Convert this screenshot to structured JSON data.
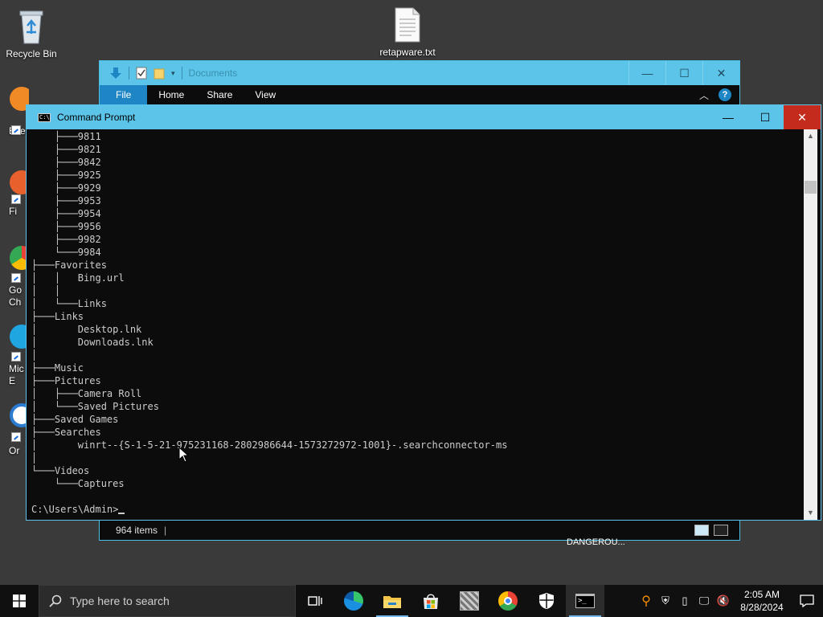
{
  "desktop": {
    "icons": [
      {
        "label": "Recycle Bin",
        "icon": "recycle-bin-icon"
      },
      {
        "label": "retapware.txt",
        "icon": "text-file-icon"
      }
    ],
    "partial_icons": [
      {
        "label": "Ever",
        "icon": "app-icon",
        "color": "#f08a24"
      },
      {
        "label": "Fi",
        "icon": "firefox-icon",
        "color": "#e8602c"
      },
      {
        "label": "Go\nCh",
        "icon": "chrome-icon",
        "color": "#34a853"
      },
      {
        "label": "Mic\nE",
        "icon": "edge-icon",
        "color": "#1fa5e0"
      },
      {
        "label": "Or",
        "icon": "app-icon",
        "color": "#2b7bd0"
      }
    ],
    "background_label": "DANGEROU..."
  },
  "explorer": {
    "title": "Documents",
    "ribbon_tabs": [
      "File",
      "Home",
      "Share",
      "View"
    ],
    "help": "?",
    "status": "964 items",
    "status_sep": "|",
    "controls": {
      "minimize": "—",
      "maximize": "☐",
      "close": "✕"
    }
  },
  "cmd": {
    "title": "Command Prompt",
    "icon_text": "C:\\",
    "controls": {
      "minimize": "—",
      "maximize": "☐",
      "close": "✕"
    },
    "lines": [
      "    ├───9811",
      "    ├───9821",
      "    ├───9842",
      "    ├───9925",
      "    ├───9929",
      "    ├───9953",
      "    ├───9954",
      "    ├───9956",
      "    ├───9982",
      "    └───9984",
      "├───Favorites",
      "│   │   Bing.url",
      "│   │",
      "│   └───Links",
      "├───Links",
      "│       Desktop.lnk",
      "│       Downloads.lnk",
      "│",
      "├───Music",
      "├───Pictures",
      "│   ├───Camera Roll",
      "│   └───Saved Pictures",
      "├───Saved Games",
      "├───Searches",
      "│       winrt--{S-1-5-21-975231168-2802986644-1573272972-1001}-.searchconnector-ms",
      "│",
      "└───Videos",
      "    └───Captures",
      ""
    ],
    "prompt": "C:\\Users\\Admin>"
  },
  "taskbar": {
    "search_placeholder": "Type here to search",
    "apps": [
      {
        "name": "task-view-icon",
        "state": "none"
      },
      {
        "name": "edge-icon",
        "state": "none"
      },
      {
        "name": "file-explorer-icon",
        "state": "running"
      },
      {
        "name": "microsoft-store-icon",
        "state": "none"
      },
      {
        "name": "app-icon",
        "state": "none"
      },
      {
        "name": "chrome-icon",
        "state": "none"
      },
      {
        "name": "security-icon",
        "state": "none"
      },
      {
        "name": "command-prompt-icon",
        "state": "active"
      }
    ],
    "time": "2:05 AM",
    "date": "8/28/2024"
  }
}
